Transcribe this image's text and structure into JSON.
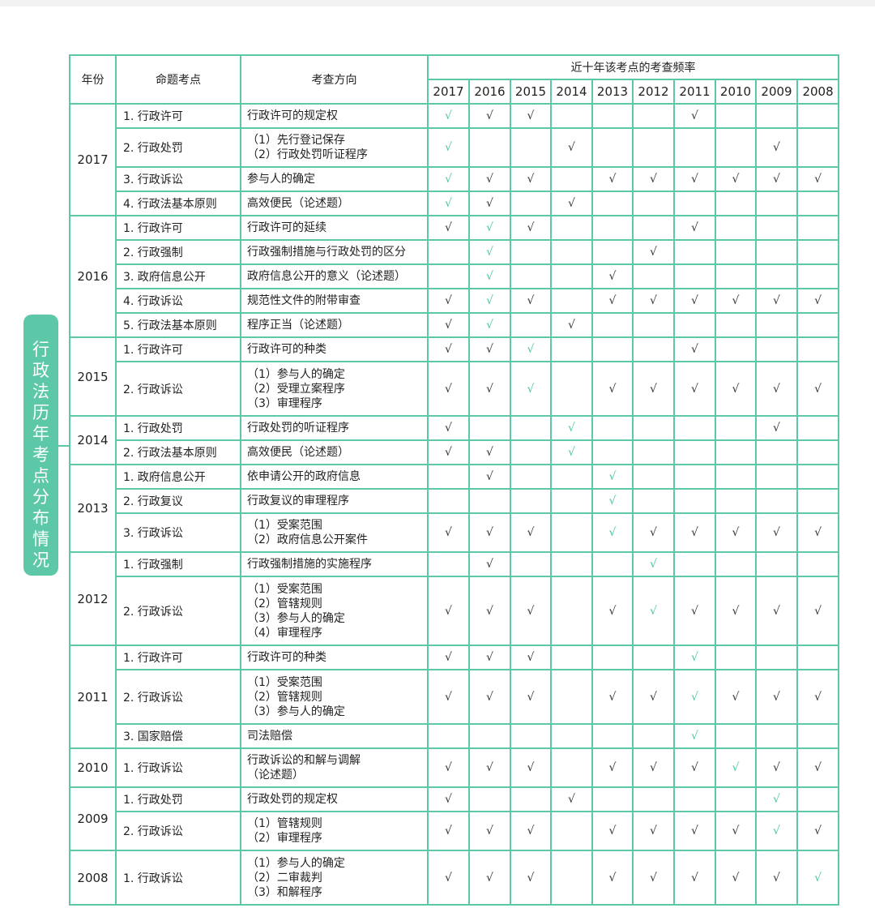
{
  "side_title": "行政法历年考点分布情况",
  "header": {
    "year": "年份",
    "topic": "命题考点",
    "direction": "考查方向",
    "freq": "近十年该考点的考查频率",
    "years": [
      "2017",
      "2016",
      "2015",
      "2014",
      "2013",
      "2012",
      "2011",
      "2010",
      "2009",
      "2008"
    ]
  },
  "check_mark": "√",
  "groups": [
    {
      "year": "2017",
      "rows": [
        {
          "topic": "1. 行政许可",
          "dir": [
            "行政许可的规定权"
          ],
          "marks": [
            1,
            1,
            1,
            0,
            0,
            0,
            1,
            0,
            0,
            0
          ]
        },
        {
          "topic": "2. 行政处罚",
          "dir": [
            "（1）先行登记保存",
            "（2）行政处罚听证程序"
          ],
          "marks": [
            1,
            0,
            0,
            1,
            0,
            0,
            0,
            0,
            1,
            0
          ]
        },
        {
          "topic": "3. 行政诉讼",
          "dir": [
            "参与人的确定"
          ],
          "marks": [
            1,
            1,
            1,
            0,
            1,
            1,
            1,
            1,
            1,
            1
          ]
        },
        {
          "topic": "4. 行政法基本原则",
          "dir": [
            "高效便民（论述题）"
          ],
          "marks": [
            1,
            1,
            0,
            1,
            0,
            0,
            0,
            0,
            0,
            0
          ]
        }
      ]
    },
    {
      "year": "2016",
      "rows": [
        {
          "topic": "1. 行政许可",
          "dir": [
            "行政许可的延续"
          ],
          "marks": [
            1,
            1,
            1,
            0,
            0,
            0,
            1,
            0,
            0,
            0
          ]
        },
        {
          "topic": "2. 行政强制",
          "dir": [
            "行政强制措施与行政处罚的区分"
          ],
          "marks": [
            0,
            1,
            0,
            0,
            0,
            1,
            0,
            0,
            0,
            0
          ]
        },
        {
          "topic": "3. 政府信息公开",
          "dir": [
            "政府信息公开的意义（论述题）"
          ],
          "marks": [
            0,
            1,
            0,
            0,
            1,
            0,
            0,
            0,
            0,
            0
          ]
        },
        {
          "topic": "4. 行政诉讼",
          "dir": [
            "规范性文件的附带审查"
          ],
          "marks": [
            1,
            1,
            1,
            0,
            1,
            1,
            1,
            1,
            1,
            1
          ]
        },
        {
          "topic": "5. 行政法基本原则",
          "dir": [
            "程序正当（论述题）"
          ],
          "marks": [
            1,
            1,
            0,
            1,
            0,
            0,
            0,
            0,
            0,
            0
          ]
        }
      ]
    },
    {
      "year": "2015",
      "rows": [
        {
          "topic": "1. 行政许可",
          "dir": [
            "行政许可的种类"
          ],
          "marks": [
            1,
            1,
            1,
            0,
            0,
            0,
            1,
            0,
            0,
            0
          ]
        },
        {
          "topic": "2. 行政诉讼",
          "dir": [
            "（1）参与人的确定",
            "（2）受理立案程序",
            "（3）审理程序"
          ],
          "marks": [
            1,
            1,
            1,
            0,
            1,
            1,
            1,
            1,
            1,
            1
          ]
        }
      ]
    },
    {
      "year": "2014",
      "rows": [
        {
          "topic": "1. 行政处罚",
          "dir": [
            "行政处罚的听证程序"
          ],
          "marks": [
            1,
            0,
            0,
            1,
            0,
            0,
            0,
            0,
            1,
            0
          ]
        },
        {
          "topic": "2. 行政法基本原则",
          "dir": [
            "高效便民（论述题）"
          ],
          "marks": [
            1,
            1,
            0,
            1,
            0,
            0,
            0,
            0,
            0,
            0
          ]
        }
      ]
    },
    {
      "year": "2013",
      "rows": [
        {
          "topic": "1. 政府信息公开",
          "dir": [
            "依申请公开的政府信息"
          ],
          "marks": [
            0,
            1,
            0,
            0,
            1,
            0,
            0,
            0,
            0,
            0
          ]
        },
        {
          "topic": "2. 行政复议",
          "dir": [
            "行政复议的审理程序"
          ],
          "marks": [
            0,
            0,
            0,
            0,
            1,
            0,
            0,
            0,
            0,
            0
          ]
        },
        {
          "topic": "3. 行政诉讼",
          "dir": [
            "（1）受案范围",
            "（2）政府信息公开案件"
          ],
          "marks": [
            1,
            1,
            1,
            0,
            1,
            1,
            1,
            1,
            1,
            1
          ]
        }
      ]
    },
    {
      "year": "2012",
      "rows": [
        {
          "topic": "1. 行政强制",
          "dir": [
            "行政强制措施的实施程序"
          ],
          "marks": [
            0,
            1,
            0,
            0,
            0,
            1,
            0,
            0,
            0,
            0
          ]
        },
        {
          "topic": "2. 行政诉讼",
          "dir": [
            "（1）受案范围",
            "（2）管辖规则",
            "（3）参与人的确定",
            "（4）审理程序"
          ],
          "marks": [
            1,
            1,
            1,
            0,
            1,
            1,
            1,
            1,
            1,
            1
          ]
        }
      ]
    },
    {
      "year": "2011",
      "rows": [
        {
          "topic": "1. 行政许可",
          "dir": [
            "行政许可的种类"
          ],
          "marks": [
            1,
            1,
            1,
            0,
            0,
            0,
            1,
            0,
            0,
            0
          ]
        },
        {
          "topic": "2. 行政诉讼",
          "dir": [
            "（1）受案范围",
            "（2）管辖规则",
            "（3）参与人的确定"
          ],
          "marks": [
            1,
            1,
            1,
            0,
            1,
            1,
            1,
            1,
            1,
            1
          ]
        },
        {
          "topic": "3. 国家赔偿",
          "dir": [
            "司法赔偿"
          ],
          "marks": [
            0,
            0,
            0,
            0,
            0,
            0,
            1,
            0,
            0,
            0
          ]
        }
      ]
    },
    {
      "year": "2010",
      "rows": [
        {
          "topic": "1. 行政诉讼",
          "dir": [
            "行政诉讼的和解与调解",
            "（论述题）"
          ],
          "marks": [
            1,
            1,
            1,
            0,
            1,
            1,
            1,
            1,
            1,
            1
          ]
        }
      ]
    },
    {
      "year": "2009",
      "rows": [
        {
          "topic": "1. 行政处罚",
          "dir": [
            "行政处罚的规定权"
          ],
          "marks": [
            1,
            0,
            0,
            1,
            0,
            0,
            0,
            0,
            1,
            0
          ]
        },
        {
          "topic": "2. 行政诉讼",
          "dir": [
            "（1）管辖规则",
            "（2）审理程序"
          ],
          "marks": [
            1,
            1,
            1,
            0,
            1,
            1,
            1,
            1,
            1,
            1
          ]
        }
      ]
    },
    {
      "year": "2008",
      "rows": [
        {
          "topic": "1. 行政诉讼",
          "dir": [
            "（1）参与人的确定",
            "（2）二审裁判",
            "（3）和解程序"
          ],
          "marks": [
            1,
            1,
            1,
            0,
            1,
            1,
            1,
            1,
            1,
            1
          ]
        }
      ]
    }
  ],
  "colors": {
    "accent": "#5cc8a8",
    "check_highlight": "#4cc7a0",
    "check": "#333333"
  }
}
